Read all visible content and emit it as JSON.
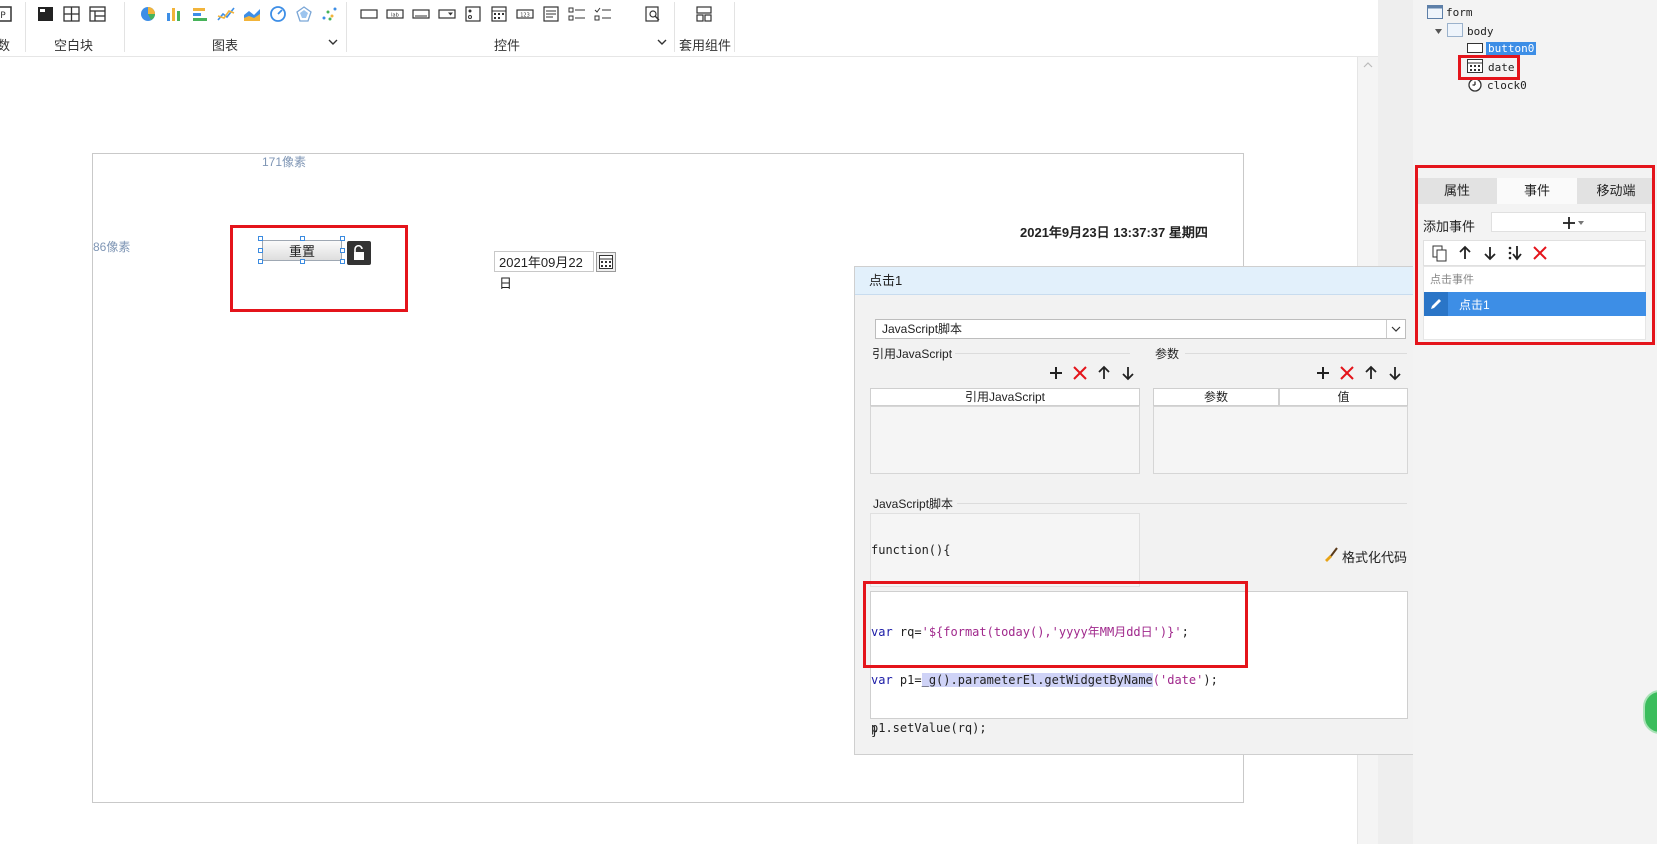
{
  "toolbar": {
    "groups": [
      {
        "label": "数"
      },
      {
        "label": "空白块"
      },
      {
        "label": "图表"
      },
      {
        "label": "控件"
      },
      {
        "label": "套用组件"
      }
    ]
  },
  "canvas": {
    "ruler_top": "171像素",
    "ruler_left": "86像素",
    "reset_button": "重置",
    "clock_text": "2021年9月23日 13:37:37 星期四",
    "date_value": "2021年09月22日"
  },
  "dialog": {
    "title": "点击1",
    "type_select": "JavaScript脚本",
    "ref_js_group": "引用JavaScript",
    "params_group": "参数",
    "ref_js_header": "引用JavaScript",
    "param_header": "参数",
    "value_header": "值",
    "script_group": "JavaScript脚本",
    "function_open": "function(){",
    "format_code": "格式化代码",
    "code_lines": {
      "l1_kw": "var",
      "l1_rest": " rq=",
      "l1_str": "'${format(today(),'yyyy年MM月dd日')}'",
      "l1_end": ";",
      "l2_kw": "var",
      "l2_rest": " p1=",
      "l2_hl": "_g().parameterEl.getWidgetByName",
      "l2_str": "('date'",
      "l2_end": ");",
      "l3": "p1.setValue(rq);"
    },
    "function_close": "}"
  },
  "panel": {
    "tree": {
      "form": "form",
      "body": "body",
      "button": "button0",
      "date": "date",
      "clock": "clock0"
    },
    "tabs": [
      "属性",
      "事件",
      "移动端"
    ],
    "add_event_label": "添加事件",
    "event_category": "点击事件",
    "event_item": "点击1"
  },
  "colors": {
    "accent": "#3d8ee6",
    "highlight_red": "#e4141b",
    "keyword": "#1a1aa6",
    "string": "#a0288c",
    "selection": "#cfd3f7"
  }
}
